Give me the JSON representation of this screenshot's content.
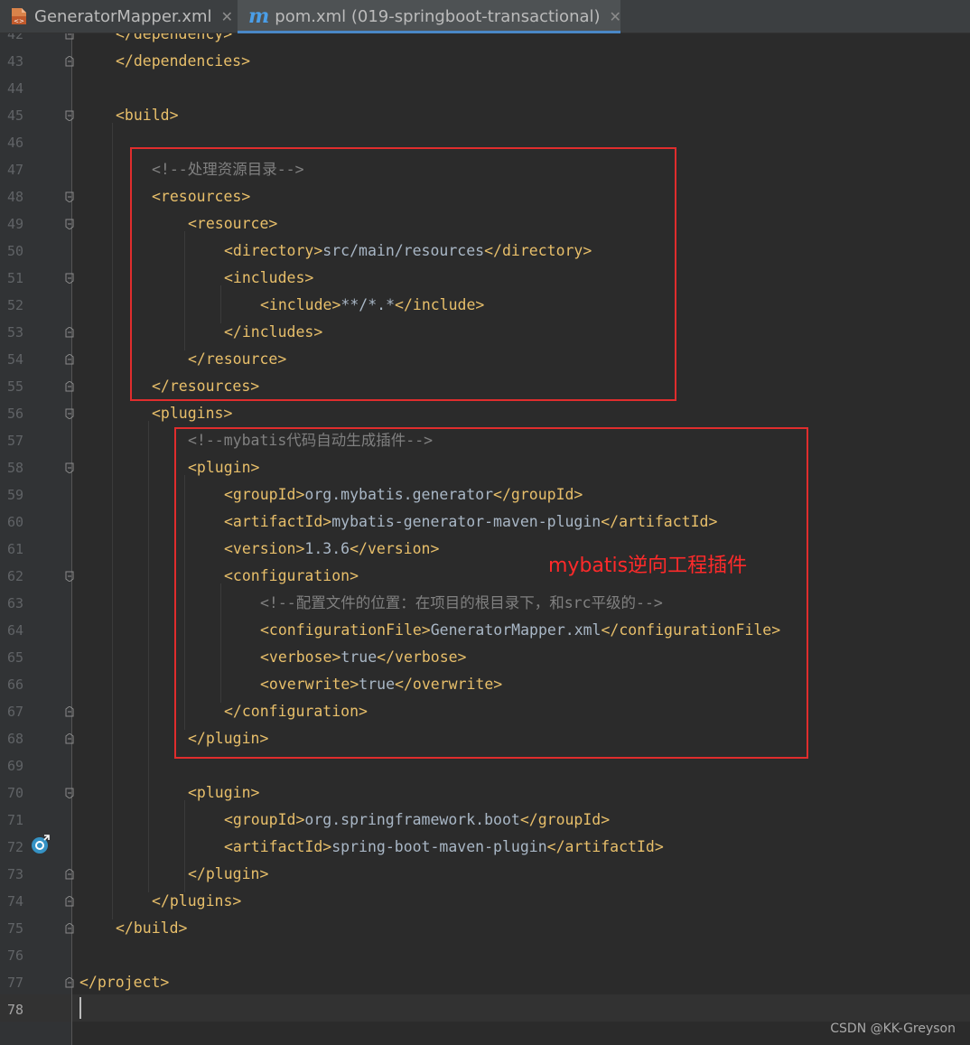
{
  "tabs": [
    {
      "label": "GeneratorMapper.xml",
      "icon": "xml-file-icon",
      "active": false
    },
    {
      "label": "pom.xml (019-springboot-transactional)",
      "icon": "maven-icon",
      "active": true
    }
  ],
  "editor": {
    "current_line": "78",
    "lines": [
      {
        "n": "42",
        "indent": 1,
        "parts": [
          {
            "t": "</dependency>",
            "c": "tag"
          }
        ]
      },
      {
        "n": "43",
        "indent": 1,
        "parts": [
          {
            "t": "</dependencies>",
            "c": "tag"
          }
        ]
      },
      {
        "n": "44",
        "indent": 0,
        "parts": []
      },
      {
        "n": "45",
        "indent": 1,
        "parts": [
          {
            "t": "<build>",
            "c": "tag"
          }
        ]
      },
      {
        "n": "46",
        "indent": 0,
        "parts": []
      },
      {
        "n": "47",
        "indent": 2,
        "parts": [
          {
            "t": "<!--处理资源目录-->",
            "c": "cmt"
          }
        ]
      },
      {
        "n": "48",
        "indent": 2,
        "parts": [
          {
            "t": "<resources>",
            "c": "tag"
          }
        ]
      },
      {
        "n": "49",
        "indent": 3,
        "parts": [
          {
            "t": "<resource>",
            "c": "tag"
          }
        ]
      },
      {
        "n": "50",
        "indent": 4,
        "parts": [
          {
            "t": "<directory>",
            "c": "tag"
          },
          {
            "t": "src/main/resources",
            "c": "txt"
          },
          {
            "t": "</directory>",
            "c": "tag"
          }
        ]
      },
      {
        "n": "51",
        "indent": 4,
        "parts": [
          {
            "t": "<includes>",
            "c": "tag"
          }
        ]
      },
      {
        "n": "52",
        "indent": 5,
        "parts": [
          {
            "t": "<include>",
            "c": "tag"
          },
          {
            "t": "**/*.*",
            "c": "txt"
          },
          {
            "t": "</include>",
            "c": "tag"
          }
        ]
      },
      {
        "n": "53",
        "indent": 4,
        "parts": [
          {
            "t": "</includes>",
            "c": "tag"
          }
        ]
      },
      {
        "n": "54",
        "indent": 3,
        "parts": [
          {
            "t": "</resource>",
            "c": "tag"
          }
        ]
      },
      {
        "n": "55",
        "indent": 2,
        "parts": [
          {
            "t": "</resources>",
            "c": "tag"
          }
        ]
      },
      {
        "n": "56",
        "indent": 2,
        "parts": [
          {
            "t": "<plugins>",
            "c": "tag"
          }
        ]
      },
      {
        "n": "57",
        "indent": 3,
        "parts": [
          {
            "t": "<!--mybatis代码自动生成插件-->",
            "c": "cmt"
          }
        ]
      },
      {
        "n": "58",
        "indent": 3,
        "parts": [
          {
            "t": "<plugin>",
            "c": "tag"
          }
        ]
      },
      {
        "n": "59",
        "indent": 4,
        "parts": [
          {
            "t": "<groupId>",
            "c": "tag"
          },
          {
            "t": "org.mybatis.generator",
            "c": "txt"
          },
          {
            "t": "</groupId>",
            "c": "tag"
          }
        ]
      },
      {
        "n": "60",
        "indent": 4,
        "parts": [
          {
            "t": "<artifactId>",
            "c": "tag"
          },
          {
            "t": "mybatis-generator-maven-plugin",
            "c": "txt"
          },
          {
            "t": "</artifactId>",
            "c": "tag"
          }
        ]
      },
      {
        "n": "61",
        "indent": 4,
        "parts": [
          {
            "t": "<version>",
            "c": "tag"
          },
          {
            "t": "1.3.6",
            "c": "txt"
          },
          {
            "t": "</version>",
            "c": "tag"
          }
        ]
      },
      {
        "n": "62",
        "indent": 4,
        "parts": [
          {
            "t": "<configuration>",
            "c": "tag"
          }
        ]
      },
      {
        "n": "63",
        "indent": 5,
        "parts": [
          {
            "t": "<!--配置文件的位置：在项目的根目录下，和src平级的-->",
            "c": "cmt"
          }
        ]
      },
      {
        "n": "64",
        "indent": 5,
        "parts": [
          {
            "t": "<configurationFile>",
            "c": "tag"
          },
          {
            "t": "GeneratorMapper.xml",
            "c": "txt"
          },
          {
            "t": "</configurationFile>",
            "c": "tag"
          }
        ]
      },
      {
        "n": "65",
        "indent": 5,
        "parts": [
          {
            "t": "<verbose>",
            "c": "tag"
          },
          {
            "t": "true",
            "c": "txt"
          },
          {
            "t": "</verbose>",
            "c": "tag"
          }
        ]
      },
      {
        "n": "66",
        "indent": 5,
        "parts": [
          {
            "t": "<overwrite>",
            "c": "tag"
          },
          {
            "t": "true",
            "c": "txt"
          },
          {
            "t": "</overwrite>",
            "c": "tag"
          }
        ]
      },
      {
        "n": "67",
        "indent": 4,
        "parts": [
          {
            "t": "</configuration>",
            "c": "tag"
          }
        ]
      },
      {
        "n": "68",
        "indent": 3,
        "parts": [
          {
            "t": "</plugin>",
            "c": "tag"
          }
        ]
      },
      {
        "n": "69",
        "indent": 0,
        "parts": []
      },
      {
        "n": "70",
        "indent": 3,
        "parts": [
          {
            "t": "<plugin>",
            "c": "tag"
          }
        ]
      },
      {
        "n": "71",
        "indent": 4,
        "parts": [
          {
            "t": "<groupId>",
            "c": "tag"
          },
          {
            "t": "org.springframework.boot",
            "c": "txt"
          },
          {
            "t": "</groupId>",
            "c": "tag"
          }
        ]
      },
      {
        "n": "72",
        "indent": 4,
        "parts": [
          {
            "t": "<artifactId>",
            "c": "tag"
          },
          {
            "t": "spring-boot-maven-plugin",
            "c": "txt"
          },
          {
            "t": "</artifactId>",
            "c": "tag"
          }
        ]
      },
      {
        "n": "73",
        "indent": 3,
        "parts": [
          {
            "t": "</plugin>",
            "c": "tag"
          }
        ]
      },
      {
        "n": "74",
        "indent": 2,
        "parts": [
          {
            "t": "</plugins>",
            "c": "tag"
          }
        ]
      },
      {
        "n": "75",
        "indent": 1,
        "parts": [
          {
            "t": "</build>",
            "c": "tag"
          }
        ]
      },
      {
        "n": "76",
        "indent": 0,
        "parts": []
      },
      {
        "n": "77",
        "indent": 0,
        "parts": [
          {
            "t": "</project>",
            "c": "tag"
          }
        ]
      },
      {
        "n": "78",
        "indent": 0,
        "parts": []
      }
    ]
  },
  "annotation": "mybatis逆向工程插件",
  "watermark": "CSDN @KK-Greyson",
  "colors": {
    "tag": "#e8bf6a",
    "text": "#a9b7c6",
    "comment": "#808080",
    "highlight_box": "#e02d2d",
    "annotation": "#ff2a2a"
  }
}
